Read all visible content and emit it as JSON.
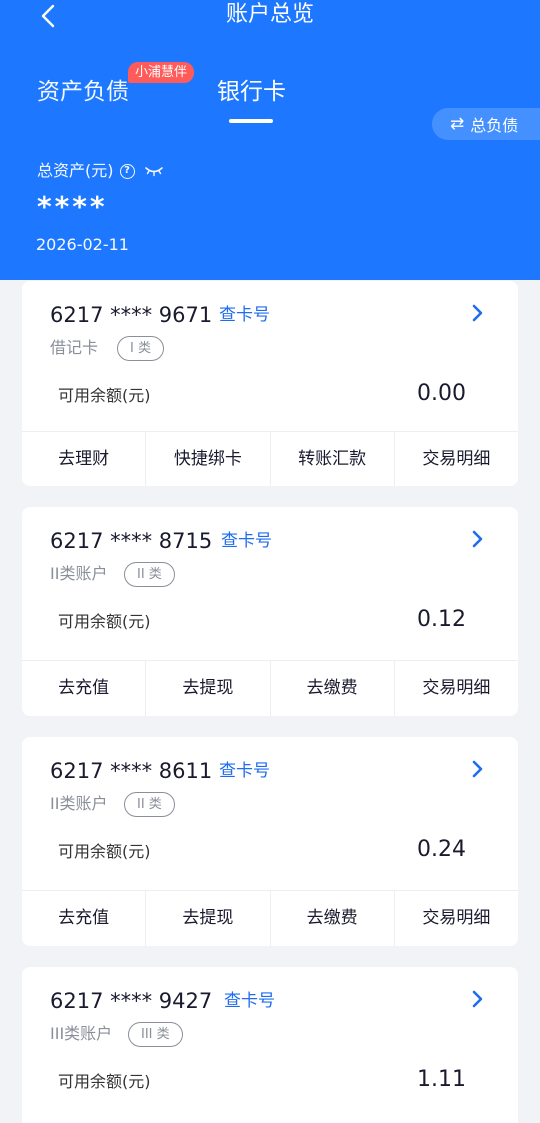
{
  "header": {
    "title": "账户总览",
    "tabs": [
      {
        "label": "资产负债",
        "badge": "小浦慧伴"
      },
      {
        "label": "银行卡"
      }
    ],
    "total_liabilities_label": "总负债",
    "assets_label": "总资产(元)",
    "assets_value": "****",
    "date": "2026-02-11"
  },
  "colors": {
    "header_bg": "#1d78ff",
    "link": "#1f6cf0",
    "badge": "#ff5b5b"
  },
  "cards": [
    {
      "number": "6217 **** 9671",
      "view_label": "查卡号",
      "type": "借记卡",
      "class_pill": "I 类",
      "balance_label": "可用余额(元)",
      "balance": "0.00",
      "actions": [
        "去理财",
        "快捷绑卡",
        "转账汇款",
        "交易明细"
      ]
    },
    {
      "number": "6217 **** 8715",
      "view_label": "查卡号",
      "type": "II类账户",
      "class_pill": "II 类",
      "balance_label": "可用余额(元)",
      "balance": "0.12",
      "actions": [
        "去充值",
        "去提现",
        "去缴费",
        "交易明细"
      ]
    },
    {
      "number": "6217 **** 8611",
      "view_label": "查卡号",
      "type": "II类账户",
      "class_pill": "II 类",
      "balance_label": "可用余额(元)",
      "balance": "0.24",
      "actions": [
        "去充值",
        "去提现",
        "去缴费",
        "交易明细"
      ]
    },
    {
      "number": "6217 **** 9427",
      "view_label": "查卡号",
      "type": "III类账户",
      "class_pill": "III 类",
      "balance_label": "可用余额(元)",
      "balance": "1.11"
    }
  ]
}
